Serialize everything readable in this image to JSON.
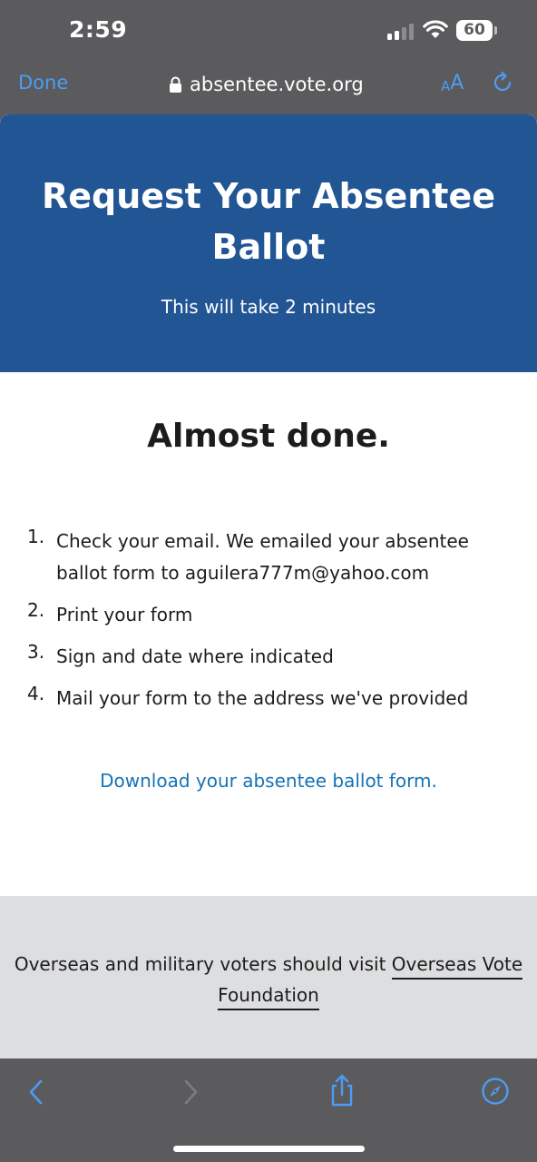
{
  "status_bar": {
    "time": "2:59",
    "battery": "60"
  },
  "browser": {
    "done_label": "Done",
    "url": "absentee.vote.org",
    "text_size_small": "A",
    "text_size_big": "A"
  },
  "hero": {
    "title": "Request Your Absentee Ballot",
    "subtitle": "This will take 2 minutes"
  },
  "main": {
    "heading": "Almost done.",
    "steps": [
      {
        "num": "1.",
        "text": "Check your email. We emailed your absentee ballot form to aguilera777m@yahoo.com"
      },
      {
        "num": "2.",
        "text": "Print your form"
      },
      {
        "num": "3.",
        "text": "Sign and date where indicated"
      },
      {
        "num": "4.",
        "text": "Mail your form to the address we've provided"
      }
    ],
    "download_link": "Download your absentee ballot form."
  },
  "footer": {
    "text": "Overseas and military voters should visit ",
    "link": "Overseas Vote Foundation"
  },
  "toolbar_icons": [
    "back-icon",
    "forward-icon",
    "share-icon",
    "compass-icon"
  ],
  "colors": {
    "accent": "#4b9cf5",
    "hero_bg": "#225594",
    "link": "#1574b6",
    "chrome_bg": "#5b5b5d",
    "footer_bg": "#dddee0"
  }
}
